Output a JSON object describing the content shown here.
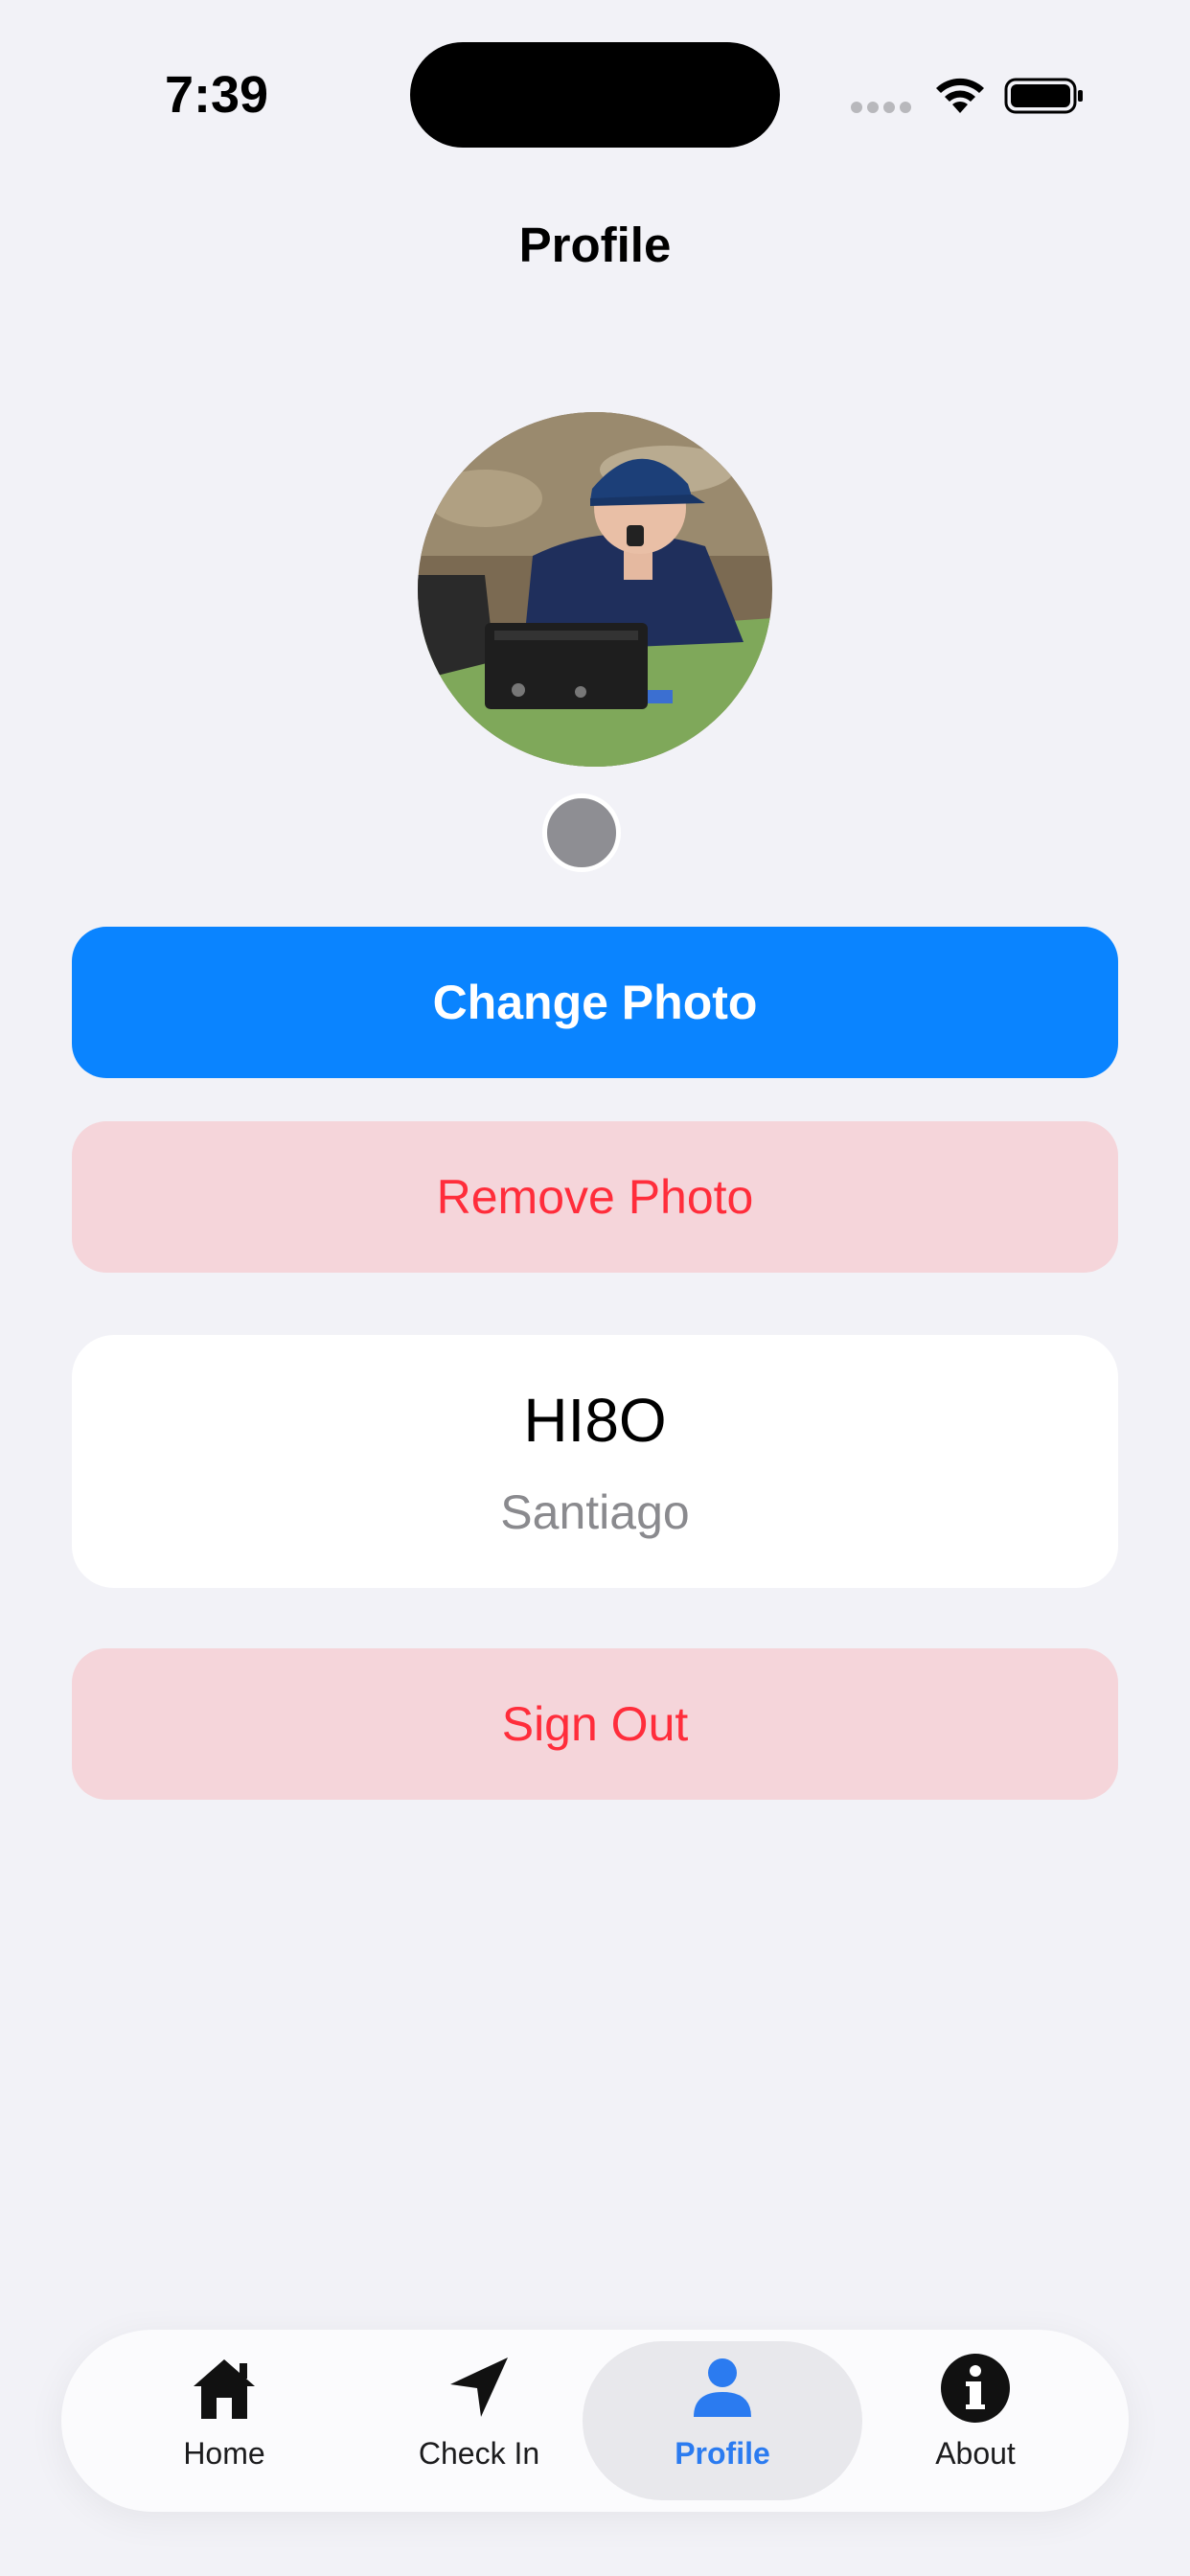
{
  "status_bar": {
    "time": "7:39"
  },
  "header": {
    "title": "Profile"
  },
  "profile": {
    "photo_alt": "Profile photo",
    "callsign": "HI8O",
    "city": "Santiago"
  },
  "actions": {
    "change_photo": "Change Photo",
    "remove_photo": "Remove Photo",
    "sign_out": "Sign Out"
  },
  "tabbar": {
    "items": [
      {
        "label": "Home",
        "icon": "house-icon"
      },
      {
        "label": "Check In",
        "icon": "location-arrow-icon"
      },
      {
        "label": "Profile",
        "icon": "person-icon",
        "active": true
      },
      {
        "label": "About",
        "icon": "info-icon"
      }
    ]
  },
  "colors": {
    "accent": "#0a84ff",
    "destructive": "#ff2d3b",
    "destructive_bg": "#f5d5da",
    "tab_active": "#2b7bf0",
    "background": "#f2f2f7"
  }
}
